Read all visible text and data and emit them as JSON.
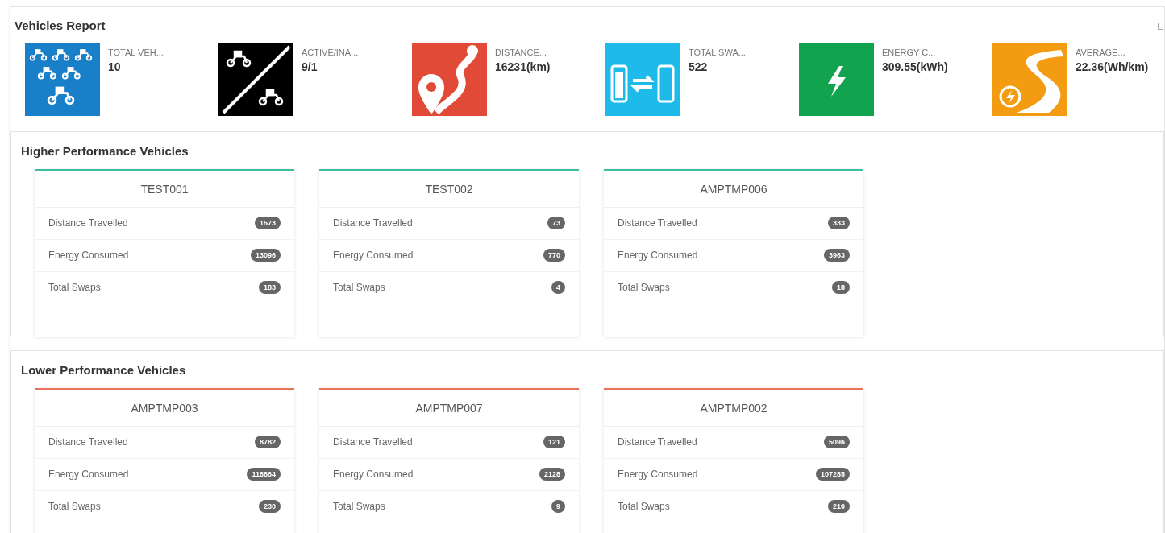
{
  "title": "Vehicles Report",
  "kpis": [
    {
      "kind": "scooters",
      "color": "#1a7fc9",
      "label": "TOTAL VEH...",
      "value": "10"
    },
    {
      "kind": "active",
      "color": "#000000",
      "label": "ACTIVE/INA...",
      "value": "9/1"
    },
    {
      "kind": "route",
      "color": "#e04a37",
      "label": "DISTANCE...",
      "value": "16231(km)"
    },
    {
      "kind": "swap",
      "color": "#1ebbea",
      "label": "TOTAL SWA...",
      "value": "522"
    },
    {
      "kind": "bolt",
      "color": "#12a34f",
      "label": "ENERGY C...",
      "value": "309.55(kWh)"
    },
    {
      "kind": "road",
      "color": "#f39c12",
      "label": "AVERAGE...",
      "value": "22.36(Wh/km)"
    }
  ],
  "sections": [
    {
      "title": "Higher Performance Vehicles",
      "color": "#3fbf9f",
      "vehicles": [
        {
          "name": "TEST001",
          "rows": [
            {
              "label": "Distance Travelled",
              "value": "1573"
            },
            {
              "label": "Energy Consumed",
              "value": "13096"
            },
            {
              "label": "Total Swaps",
              "value": "183"
            }
          ]
        },
        {
          "name": "TEST002",
          "rows": [
            {
              "label": "Distance Travelled",
              "value": "73"
            },
            {
              "label": "Energy Consumed",
              "value": "770"
            },
            {
              "label": "Total Swaps",
              "value": "4"
            }
          ]
        },
        {
          "name": "AMPTMP006",
          "rows": [
            {
              "label": "Distance Travelled",
              "value": "333"
            },
            {
              "label": "Energy Consumed",
              "value": "3963"
            },
            {
              "label": "Total Swaps",
              "value": "18"
            }
          ]
        }
      ]
    },
    {
      "title": "Lower Performance Vehicles",
      "color": "#e8735a",
      "vehicles": [
        {
          "name": "AMPTMP003",
          "rows": [
            {
              "label": "Distance Travelled",
              "value": "8782"
            },
            {
              "label": "Energy Consumed",
              "value": "118864"
            },
            {
              "label": "Total Swaps",
              "value": "230"
            }
          ]
        },
        {
          "name": "AMPTMP007",
          "rows": [
            {
              "label": "Distance Travelled",
              "value": "121"
            },
            {
              "label": "Energy Consumed",
              "value": "2128"
            },
            {
              "label": "Total Swaps",
              "value": "9"
            }
          ]
        },
        {
          "name": "AMPTMP002",
          "rows": [
            {
              "label": "Distance Travelled",
              "value": "5096"
            },
            {
              "label": "Energy Consumed",
              "value": "107285"
            },
            {
              "label": "Total Swaps",
              "value": "210"
            }
          ]
        }
      ]
    }
  ]
}
